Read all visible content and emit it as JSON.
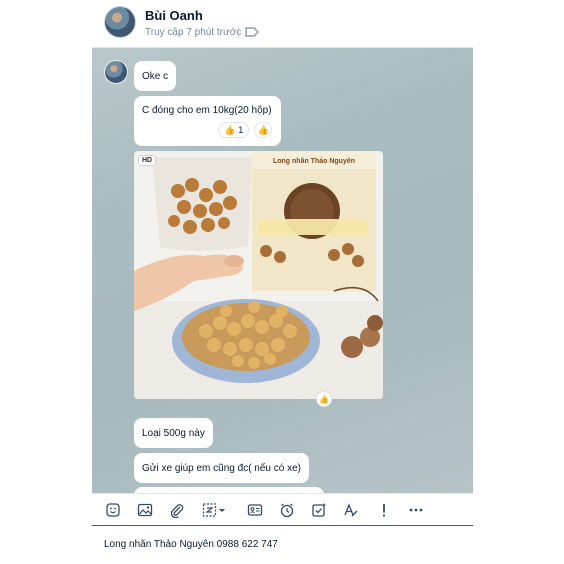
{
  "header": {
    "contact_name": "Bùi Oanh",
    "last_seen": "Truy cập 7 phút trước",
    "tag_icon": "tag-icon"
  },
  "messages": [
    {
      "text": "Oke c"
    },
    {
      "text": "C đóng cho em 10kg(20 hộp)",
      "reactions": [
        {
          "emoji": "👍",
          "count": "1"
        }
      ]
    },
    {
      "type": "image",
      "badge": "HD",
      "product_title": "Long nhãn Thảo Nguyên"
    },
    {
      "text": "Loại 500g này"
    },
    {
      "text": "Gửi xe giúp em cũng đc( nếu có xe)"
    }
  ],
  "toolbar": {
    "icons": [
      "sticker-icon",
      "image-icon",
      "attachment-icon",
      "screenshot-icon",
      "contact-card-icon",
      "reminder-icon",
      "task-icon",
      "format-icon",
      "important-icon",
      "more-icon"
    ]
  },
  "composer": {
    "value": "Long nhãn Thảo Nguyên 0988 622 747"
  },
  "colors": {
    "accent": "#0068ff",
    "chat_bg": "#a9bcc0",
    "bubble": "#ffffff"
  }
}
